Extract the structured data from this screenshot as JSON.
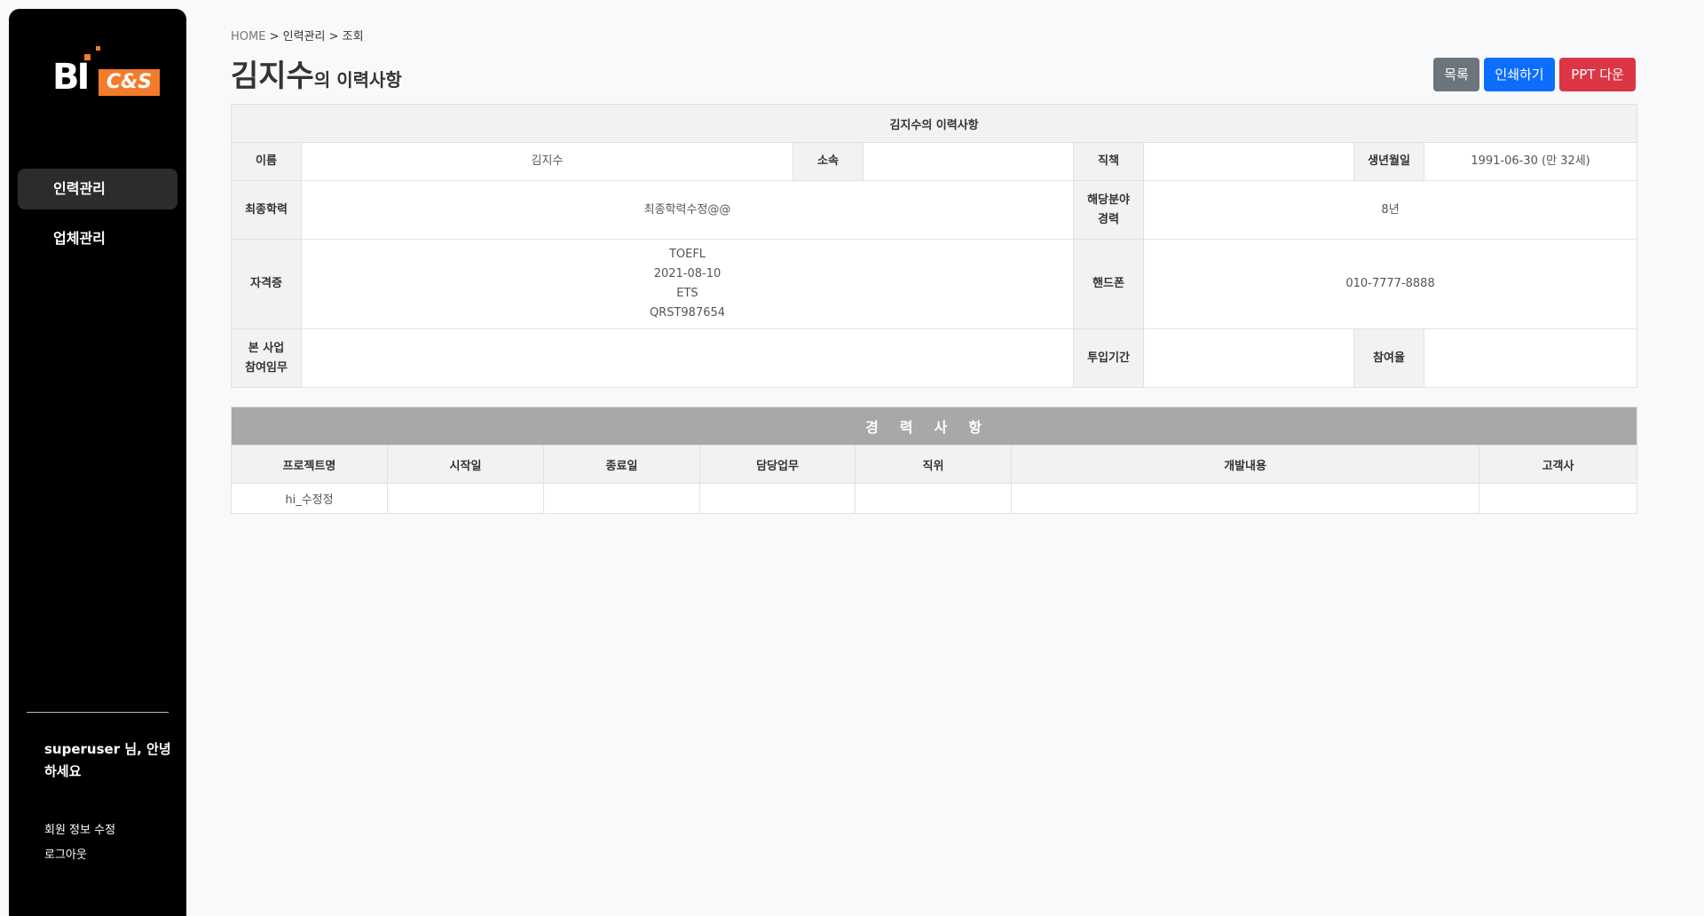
{
  "sidebar": {
    "logo": {
      "bi_text": "BI",
      "cs_text": "C&S",
      "accent": "#f47b29"
    },
    "nav": [
      {
        "label": "인력관리",
        "active": true
      },
      {
        "label": "업체관리",
        "active": false
      }
    ],
    "greeting": "superuser 님, 안녕하세요",
    "links": [
      "회원 정보 수정",
      "로그아웃"
    ]
  },
  "breadcrumb": {
    "home": "HOME",
    "sep": ">",
    "section": "인력관리",
    "page": "조회"
  },
  "title": {
    "name": "김지수",
    "suffix": "의 이력사항"
  },
  "buttons": {
    "list": "목록",
    "print": "인쇄하기",
    "ppt": "PPT 다운"
  },
  "colors": {
    "list_btn": "#6c757d",
    "print_btn": "#0d6efd",
    "ppt_btn": "#dc3545",
    "banner": "#a8a8a8"
  },
  "profile": {
    "table_title": "김지수의 이력사항",
    "labels": {
      "name": "이름",
      "affiliation": "소속",
      "position": "직책",
      "birth": "생년월일",
      "education": "최종학력",
      "experience_line1": "해당분야",
      "experience_line2": "경력",
      "certificate": "자격증",
      "phone": "핸드폰",
      "duty_line1": "본 사업",
      "duty_line2": "참여임무",
      "period": "투입기간",
      "participation": "참여율"
    },
    "values": {
      "name": "김지수",
      "affiliation": "",
      "position": "",
      "birth": "1991-06-30 (만 32세)",
      "education": "최종학력수정@@",
      "experience": "8년",
      "certificate": [
        "TOEFL",
        "2021-08-10",
        "ETS",
        "QRST987654"
      ],
      "phone": "010-7777-8888",
      "duty": "",
      "period": "",
      "participation": ""
    }
  },
  "career": {
    "banner": "경력사항",
    "columns": [
      "프로젝트명",
      "시작일",
      "종료일",
      "담당업무",
      "직위",
      "개발내용",
      "고객사"
    ],
    "rows": [
      [
        "hi_수정정",
        "",
        "",
        "",
        "",
        "",
        ""
      ]
    ]
  }
}
